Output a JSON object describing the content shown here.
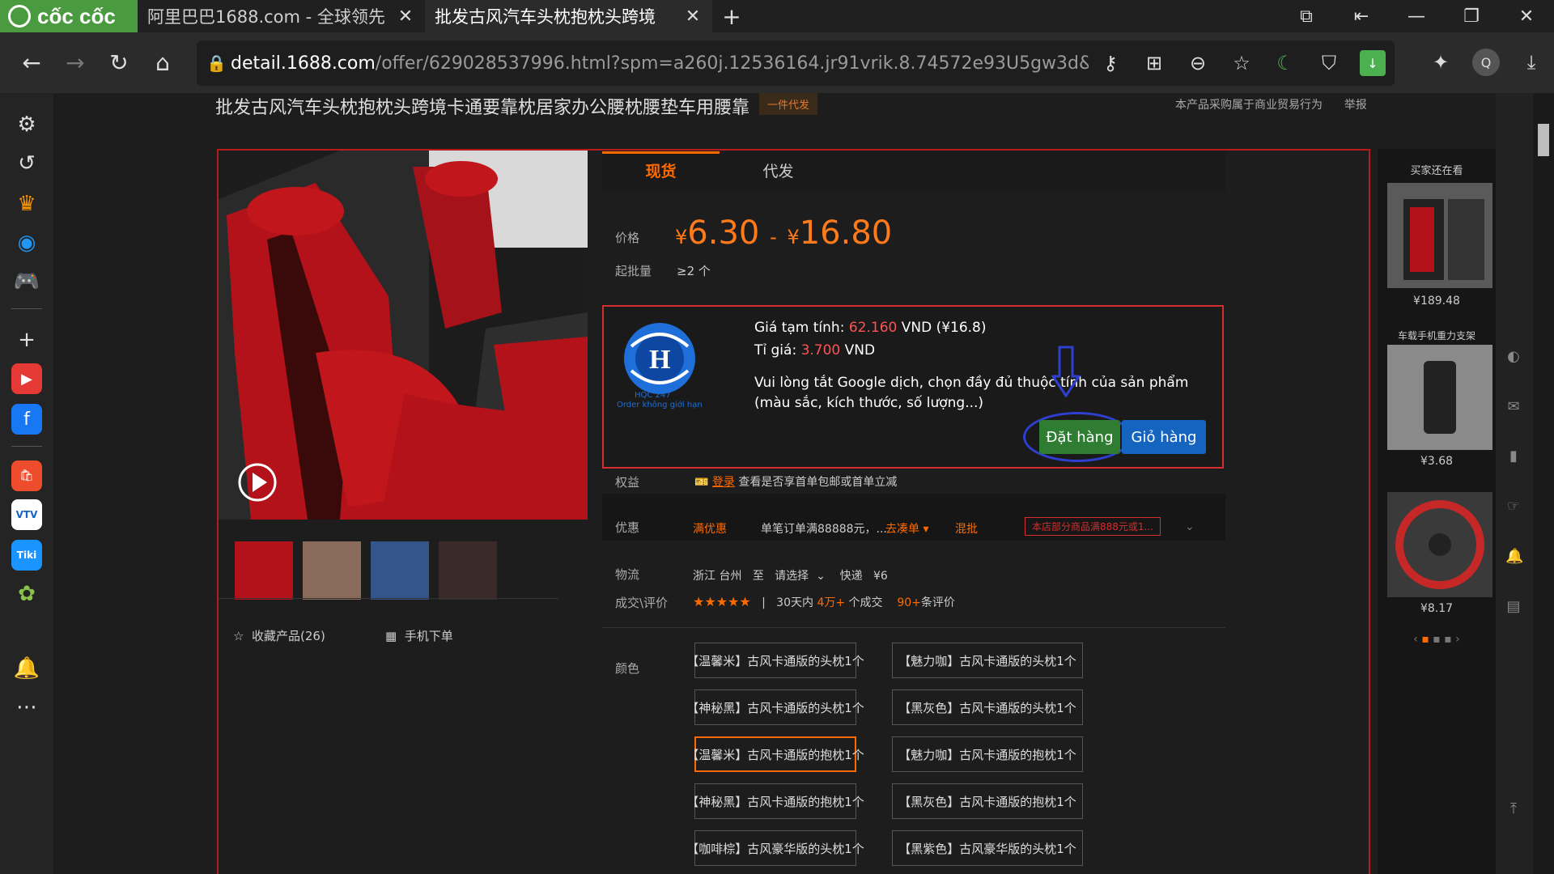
{
  "browser": {
    "logo": "cốc cốc",
    "tabs": [
      {
        "title": "阿里巴巴1688.com - 全球领先",
        "fav": "e"
      },
      {
        "title": "批发古风汽车头枕抱枕头跨境",
        "fav": "e"
      }
    ],
    "url_host": "detail.1688.com",
    "url_path": "/offer/629028537996.html?spm=a260j.12536164.jr91vrik.8.74572e93U5gw3d&&scm=1007.308...",
    "avatar": "Q"
  },
  "product": {
    "title": "批发古风汽车头枕抱枕头跨境卡通要靠枕居家办公腰枕腰垫车用腰靠",
    "dropship_badge": "一件代发",
    "report_text": "本产品采购属于商业贸易行为",
    "report_link": "举报",
    "tabs": [
      "现货",
      "代发"
    ],
    "price_label": "价格",
    "price_min": "6.30",
    "price_sep": "-",
    "price_max": "16.80",
    "currency": "¥",
    "moq_label": "起批量",
    "moq_value": "≥2 个",
    "collect": "收藏产品(26)",
    "mobile_order": "手机下单"
  },
  "extension": {
    "logo_text": "HQC 247",
    "logo_sub": "Order không giới hạn",
    "est_label": "Giá tạm tính: ",
    "est_vnd": "62.160",
    "est_rest": " VND (¥16.8)",
    "rate_label": "Tỉ giá: ",
    "rate_value": "3.700",
    "rate_unit": " VND",
    "message": "Vui lòng tắt Google dịch, chọn đầy đủ thuộc tính của sản phẩm (màu sắc, kích thước, số lượng...)",
    "order_button": "Đặt hàng",
    "cart_button": "Giỏ hàng"
  },
  "details": {
    "rights_label": "权益",
    "login": "登录",
    "rights_text": "查看是否享首单包邮或首单立减",
    "promo_label": "优惠",
    "promo_tag": "满优惠",
    "promo_text": "单笔订单满88888元，...",
    "promo_link": "去凑单",
    "mix_tag": "混批",
    "mix_text": "本店部分商品满888元或1...",
    "logistics_label": "物流",
    "from": "浙江 台州",
    "to_word": "至",
    "select": "请选择",
    "express": "快递",
    "fee": "¥6",
    "deals_label": "成交\\评价",
    "stars": "★★★★★",
    "sep": "|",
    "sold_pre": "30天内",
    "sold_num": "4万+",
    "sold_post": "个成交",
    "reviews_num": "90+",
    "reviews_post": "条评价",
    "color_label": "颜色"
  },
  "colors": [
    "【温馨米】古风卡通版的头枕1个",
    "【魅力咖】古风卡通版的头枕1个",
    "【神秘黑】古风卡通版的头枕1个",
    "【黑灰色】古风卡通版的头枕1个",
    "【温馨米】古风卡通版的抱枕1个",
    "【魅力咖】古风卡通版的抱枕1个",
    "【神秘黑】古风卡通版的抱枕1个",
    "【黑灰色】古风卡通版的抱枕1个",
    "【咖啡棕】古风豪华版的头枕1个",
    "【黑紫色】古风豪华版的头枕1个"
  ],
  "side": {
    "title": "买家还在看",
    "items": [
      {
        "price": "¥189.48",
        "caption": ""
      },
      {
        "price": "¥3.68",
        "caption": "车载手机重力支架"
      },
      {
        "price": "¥8.17",
        "caption": ""
      }
    ]
  }
}
